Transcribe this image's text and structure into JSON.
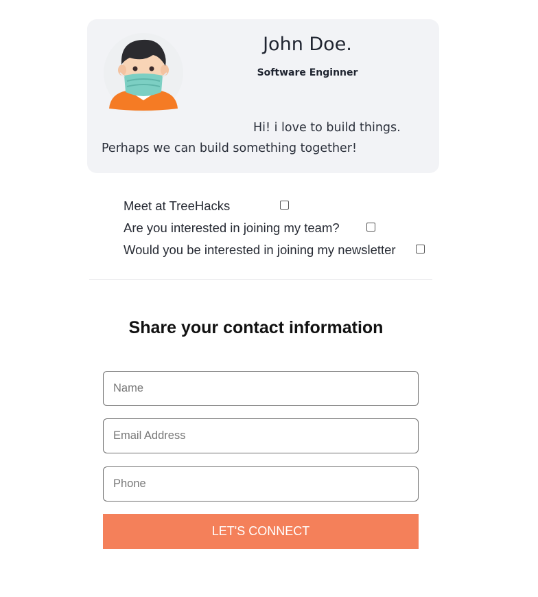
{
  "profile": {
    "avatar_icon": "masked-person-avatar-icon",
    "name": "John Doe.",
    "role": "Software Enginner",
    "bio_line1": "Hi! i love to build things.",
    "bio_line2": "Perhaps we can build something together!"
  },
  "options": [
    {
      "label": "Meet at TreeHacks",
      "checked": false
    },
    {
      "label": "Are you interested in joining my team?",
      "checked": false
    },
    {
      "label": "Would you be interested in joining my newsletter",
      "checked": false
    }
  ],
  "contact": {
    "title": "Share your contact information",
    "name_placeholder": "Name",
    "email_placeholder": "Email Address",
    "phone_placeholder": "Phone",
    "button_label": "LET'S CONNECT"
  },
  "colors": {
    "card_bg": "#f2f3f6",
    "accent": "#f4805a",
    "mask": "#7ccfc3",
    "shirt": "#f57b24"
  }
}
